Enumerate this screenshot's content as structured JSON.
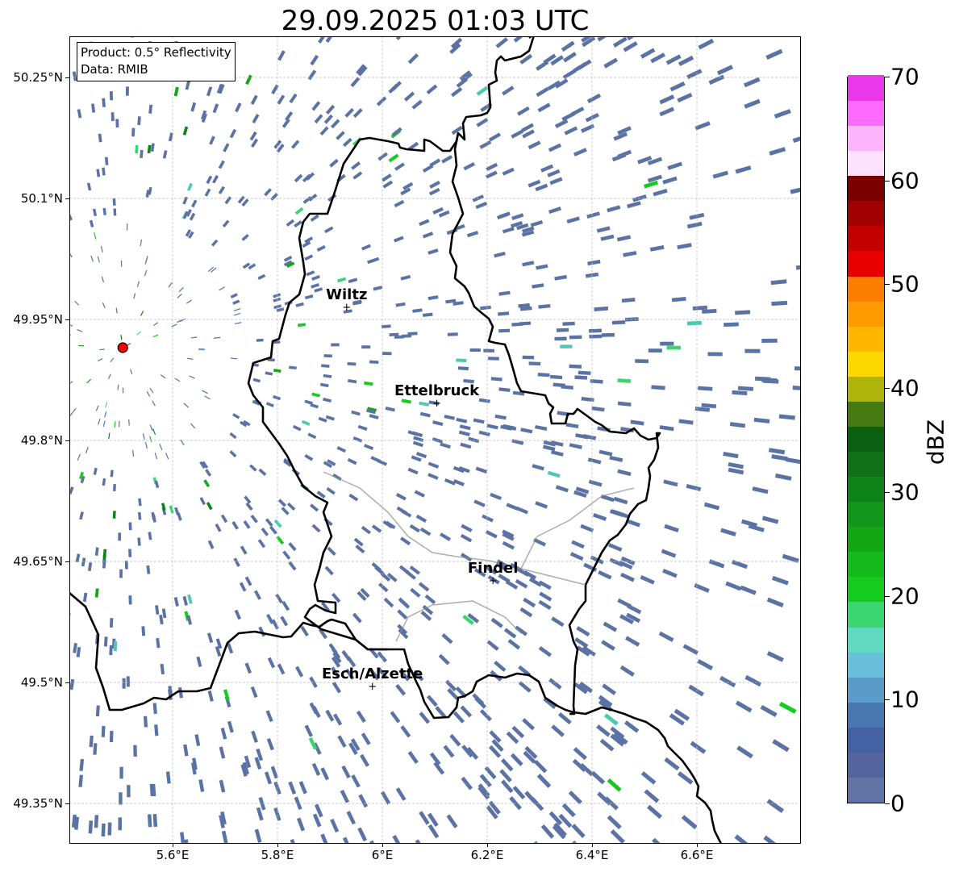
{
  "title": "29.09.2025 01:03 UTC",
  "info": {
    "product": "Product: 0.5° Reflectivity",
    "data": "Data: RMIB"
  },
  "axes": {
    "lon_range": [
      5.4,
      6.8
    ],
    "lat_range": [
      49.3,
      50.3
    ],
    "x_ticks": [
      {
        "value": 5.6,
        "label": "5.6°E"
      },
      {
        "value": 5.8,
        "label": "5.8°E"
      },
      {
        "value": 6.0,
        "label": "6°E"
      },
      {
        "value": 6.2,
        "label": "6.2°E"
      },
      {
        "value": 6.4,
        "label": "6.4°E"
      },
      {
        "value": 6.6,
        "label": "6.6°E"
      }
    ],
    "y_ticks": [
      {
        "value": 49.35,
        "label": "49.35°N"
      },
      {
        "value": 49.5,
        "label": "49.5°N"
      },
      {
        "value": 49.65,
        "label": "49.65°N"
      },
      {
        "value": 49.8,
        "label": "49.8°N"
      },
      {
        "value": 49.95,
        "label": "49.95°N"
      },
      {
        "value": 50.1,
        "label": "50.1°N"
      },
      {
        "value": 50.25,
        "label": "50.25°N"
      }
    ],
    "grid": true
  },
  "radar_site": {
    "lon": 5.505,
    "lat": 49.915,
    "color": "#ff0000"
  },
  "cities": [
    {
      "name": "Wiltz",
      "lon": 5.932,
      "lat": 49.966
    },
    {
      "name": "Ettelbruck",
      "lon": 6.104,
      "lat": 49.847
    },
    {
      "name": "Findel",
      "lon": 6.211,
      "lat": 49.627
    },
    {
      "name": "Esch/Alzette",
      "lon": 5.981,
      "lat": 49.496
    }
  ],
  "colorbar": {
    "label": "dBZ",
    "range": [
      0,
      70
    ],
    "ticks": [
      {
        "value": 0,
        "label": "0"
      },
      {
        "value": 10,
        "label": "10"
      },
      {
        "value": 20,
        "label": "20"
      },
      {
        "value": 30,
        "label": "30"
      },
      {
        "value": 40,
        "label": "40"
      },
      {
        "value": 50,
        "label": "50"
      },
      {
        "value": 60,
        "label": "60"
      },
      {
        "value": 70,
        "label": "70"
      }
    ],
    "colors": [
      "#6273a6",
      "#52659e",
      "#4361a3",
      "#4878b0",
      "#5a9bc7",
      "#68c0da",
      "#5fd9c0",
      "#3ad670",
      "#15cb1c",
      "#14b91b",
      "#13a716",
      "#11951a",
      "#0f8319",
      "#0e7117",
      "#0b5f11",
      "#447a0f",
      "#aeb40a",
      "#fdd800",
      "#fdb700",
      "#fd9a00",
      "#fd7d00",
      "#e80000",
      "#c20000",
      "#a10000",
      "#7a0000",
      "#fde0fd",
      "#fdb6fd",
      "#fd6bfd",
      "#ea38ea"
    ]
  },
  "colors": {
    "base_echo": "#5a72a4",
    "border": "#000000",
    "grid": "#bbbbbb"
  }
}
